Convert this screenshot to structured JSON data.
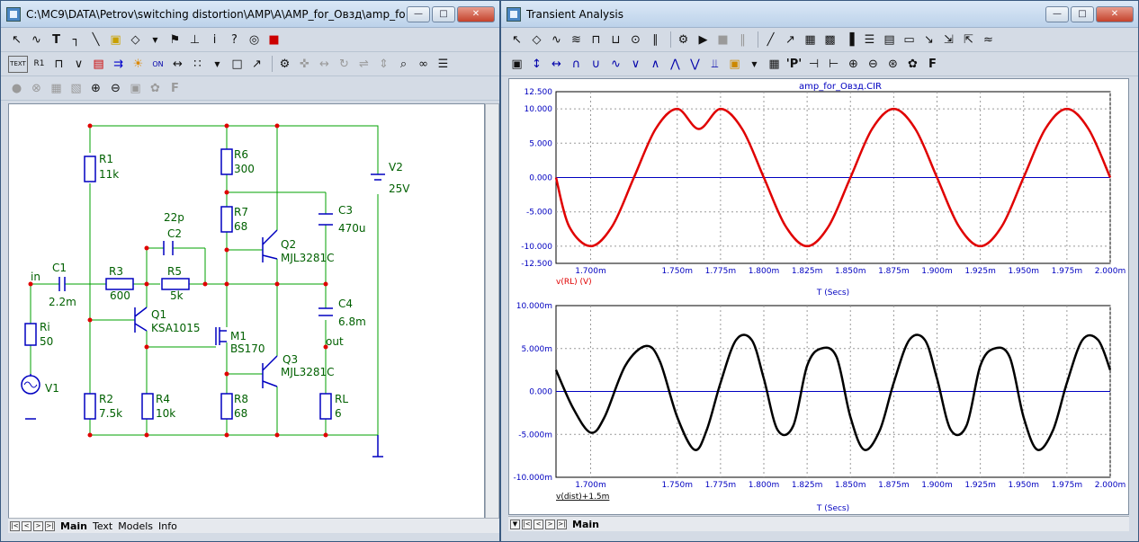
{
  "left_window": {
    "title": "C:\\MC9\\DATA\\Petrov\\switching distortion\\AMP\\A\\AMP_for_Овзд\\amp_for_O...",
    "tabs": [
      "Main",
      "Text",
      "Models",
      "Info"
    ],
    "active_tab": "Main"
  },
  "right_window": {
    "title": "Transient Analysis",
    "tabs": [
      "Main"
    ],
    "active_tab": "Main"
  },
  "toolbar_labels": {
    "text_tool": "TEXT",
    "on_tool": "ON",
    "p_tool": "'P'",
    "f_tool": "F"
  },
  "schematic": {
    "components": {
      "r1": {
        "name": "R1",
        "value": "11k"
      },
      "r2": {
        "name": "R2",
        "value": "7.5k"
      },
      "r3": {
        "name": "R3",
        "value": "600"
      },
      "r4": {
        "name": "R4",
        "value": "10k"
      },
      "r5": {
        "name": "R5",
        "value": "5k"
      },
      "r6": {
        "name": "R6",
        "value": "300"
      },
      "r7": {
        "name": "R7",
        "value": "68"
      },
      "r8": {
        "name": "R8",
        "value": "68"
      },
      "ri": {
        "name": "Ri",
        "value": "50"
      },
      "rl": {
        "name": "RL",
        "value": "6"
      },
      "c1": {
        "name": "C1",
        "value": "2.2m"
      },
      "c2": {
        "name": "C2",
        "value": "22p"
      },
      "c3": {
        "name": "C3",
        "value": "470u"
      },
      "c4": {
        "name": "C4",
        "value": "6.8m"
      },
      "q1": {
        "name": "Q1",
        "value": "KSA1015"
      },
      "q2": {
        "name": "Q2",
        "value": "MJL3281C"
      },
      "q3": {
        "name": "Q3",
        "value": "MJL3281C"
      },
      "m1": {
        "name": "M1",
        "value": "BS170"
      },
      "v1": {
        "name": "V1",
        "value": ""
      },
      "v2": {
        "name": "V2",
        "value": "25V"
      }
    },
    "node_labels": {
      "in": "in",
      "out": "out"
    }
  },
  "chart_data": [
    {
      "type": "line",
      "title": "amp_for_Овзд.CIR",
      "xlabel": "T (Secs)",
      "ylabel": "v(RL) (V)",
      "xlim": [
        1.68,
        2.0
      ],
      "ylim": [
        -12.5,
        12.5
      ],
      "x_ticks": [
        "1.700m",
        "1.750m",
        "1.775m",
        "1.800m",
        "1.825m",
        "1.850m",
        "1.875m",
        "1.900m",
        "1.925m",
        "1.950m",
        "1.975m",
        "2.000m"
      ],
      "x_tick_values": [
        1.7,
        1.75,
        1.775,
        1.8,
        1.825,
        1.85,
        1.875,
        1.9,
        1.925,
        1.95,
        1.975,
        2.0
      ],
      "y_ticks": [
        "12.500",
        "10.000",
        "5.000",
        "0.000",
        "-5.000",
        "-10.000",
        "-12.500"
      ],
      "y_tick_values": [
        12.5,
        10,
        5,
        0,
        -5,
        -10,
        -12.5
      ],
      "grid": true,
      "series": [
        {
          "name": "v(RL) (V)",
          "color": "#e00000",
          "x": [
            1.68,
            1.6875,
            1.7,
            1.7125,
            1.725,
            1.7375,
            1.75,
            1.7625,
            1.775,
            1.7875,
            1.8,
            1.8125,
            1.825,
            1.8375,
            1.85,
            1.8625,
            1.875,
            1.8875,
            1.9,
            1.9125,
            1.925,
            1.9375,
            1.95,
            1.9625,
            1.975,
            1.9875,
            2.0
          ],
          "y": [
            0.0,
            -7.07,
            -10.0,
            -7.07,
            0.0,
            7.07,
            10.0,
            7.07,
            10.0,
            7.07,
            0.0,
            -7.07,
            -10.0,
            -7.07,
            0.0,
            7.07,
            10.0,
            7.07,
            0.0,
            -7.07,
            -10.0,
            -7.07,
            0.0,
            7.07,
            10.0,
            7.07,
            0.0
          ]
        }
      ]
    },
    {
      "type": "line",
      "title": "",
      "xlabel": "T (Secs)",
      "ylabel": "v(dist)+1.5m",
      "xlim": [
        1.68,
        2.0
      ],
      "ylim": [
        -10,
        10
      ],
      "x_ticks": [
        "1.700m",
        "1.750m",
        "1.775m",
        "1.800m",
        "1.825m",
        "1.850m",
        "1.875m",
        "1.900m",
        "1.925m",
        "1.950m",
        "1.975m",
        "2.000m"
      ],
      "x_tick_values": [
        1.7,
        1.75,
        1.775,
        1.8,
        1.825,
        1.85,
        1.875,
        1.9,
        1.925,
        1.95,
        1.975,
        2.0
      ],
      "y_ticks": [
        "10.000m",
        "5.000m",
        "0.000",
        "-5.000m",
        "-10.000m"
      ],
      "y_tick_values": [
        10,
        5,
        0,
        -5,
        -10
      ],
      "grid": true,
      "series": [
        {
          "name": "v(dist)+1.5m",
          "color": "#000000",
          "x": [
            1.68,
            1.69,
            1.7,
            1.708,
            1.72,
            1.732,
            1.74,
            1.75,
            1.76,
            1.767,
            1.775,
            1.784,
            1.793,
            1.8,
            1.808,
            1.817,
            1.825,
            1.833,
            1.842,
            1.85,
            1.858,
            1.867,
            1.875,
            1.884,
            1.893,
            1.9,
            1.908,
            1.917,
            1.925,
            1.933,
            1.942,
            1.95,
            1.958,
            1.967,
            1.975,
            1.984,
            1.993,
            2.0
          ],
          "y": [
            2.5,
            -2.0,
            -4.8,
            -3.0,
            3.0,
            5.3,
            3.5,
            -3.0,
            -6.8,
            -4.5,
            1.0,
            6.0,
            6.0,
            1.5,
            -4.5,
            -4.0,
            3.0,
            5.0,
            4.0,
            -3.0,
            -6.8,
            -4.5,
            1.0,
            6.0,
            6.0,
            1.5,
            -4.5,
            -4.0,
            3.0,
            5.0,
            4.0,
            -3.0,
            -6.8,
            -4.5,
            1.0,
            6.0,
            6.0,
            2.5
          ]
        }
      ]
    }
  ]
}
